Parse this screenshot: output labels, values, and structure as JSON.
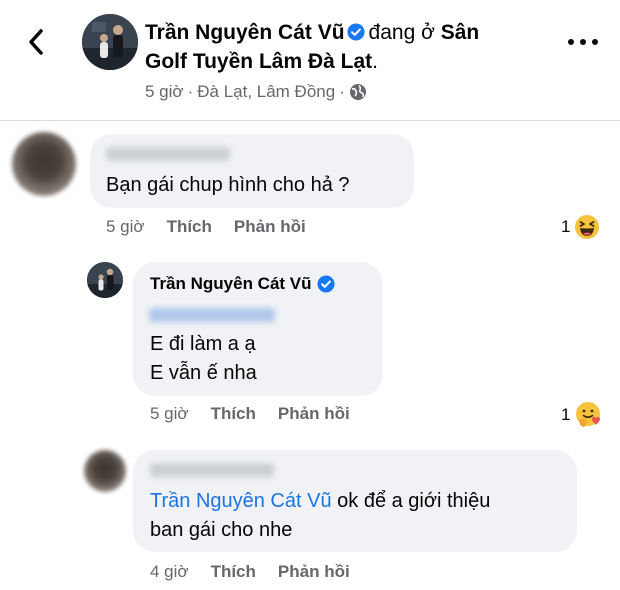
{
  "header": {
    "author_name": "Trần Nguyên Cát Vũ",
    "checkin_prefix": "đang ở",
    "location_line1": "Sân",
    "location_line2": "Golf Tuyền Lâm Đà Lạt",
    "location_end": ".",
    "time": "5 giờ",
    "separator": "·",
    "place": "Đà Lạt, Lâm Đồng",
    "icons": {
      "back": "back-arrow-icon",
      "more": "more-options-icon",
      "privacy": "globe-icon",
      "verified": "verified-badge-icon"
    }
  },
  "comments": [
    {
      "text": "Bạn gái chup hình cho hả ?",
      "time": "5 giờ",
      "like_label": "Thích",
      "reply_label": "Phản hồi",
      "reaction_count": "1",
      "reaction": "haha"
    },
    {
      "author": "Trần Nguyên Cát Vũ",
      "line1": "E đi làm a ạ",
      "line2": "E vẫn ế nha",
      "time": "5 giờ",
      "like_label": "Thích",
      "reply_label": "Phản hồi",
      "reaction_count": "1",
      "reaction": "care"
    },
    {
      "mention": "Trần Nguyên Cát Vũ",
      "line1_rest": " ok để a giới thiệu",
      "line2": "ban gái cho nhe",
      "time": "4 giờ",
      "like_label": "Thích",
      "reply_label": "Phản hồi"
    }
  ],
  "colors": {
    "verified": "#1877f2",
    "link": "#1b74e4",
    "bubble": "#f0f2f5",
    "secondary_text": "#65676b"
  }
}
